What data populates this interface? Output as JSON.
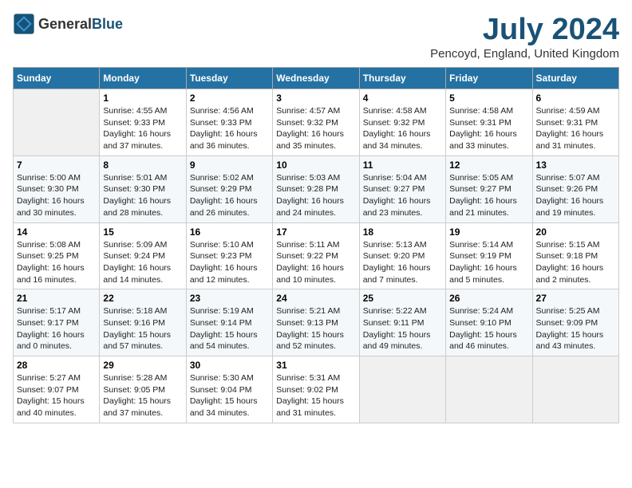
{
  "header": {
    "logo_general": "General",
    "logo_blue": "Blue",
    "title": "July 2024",
    "subtitle": "Pencoyd, England, United Kingdom"
  },
  "days_of_week": [
    "Sunday",
    "Monday",
    "Tuesday",
    "Wednesday",
    "Thursday",
    "Friday",
    "Saturday"
  ],
  "weeks": [
    {
      "days": [
        {
          "num": "",
          "info": ""
        },
        {
          "num": "1",
          "info": "Sunrise: 4:55 AM\nSunset: 9:33 PM\nDaylight: 16 hours\nand 37 minutes."
        },
        {
          "num": "2",
          "info": "Sunrise: 4:56 AM\nSunset: 9:33 PM\nDaylight: 16 hours\nand 36 minutes."
        },
        {
          "num": "3",
          "info": "Sunrise: 4:57 AM\nSunset: 9:32 PM\nDaylight: 16 hours\nand 35 minutes."
        },
        {
          "num": "4",
          "info": "Sunrise: 4:58 AM\nSunset: 9:32 PM\nDaylight: 16 hours\nand 34 minutes."
        },
        {
          "num": "5",
          "info": "Sunrise: 4:58 AM\nSunset: 9:31 PM\nDaylight: 16 hours\nand 33 minutes."
        },
        {
          "num": "6",
          "info": "Sunrise: 4:59 AM\nSunset: 9:31 PM\nDaylight: 16 hours\nand 31 minutes."
        }
      ]
    },
    {
      "days": [
        {
          "num": "7",
          "info": "Sunrise: 5:00 AM\nSunset: 9:30 PM\nDaylight: 16 hours\nand 30 minutes."
        },
        {
          "num": "8",
          "info": "Sunrise: 5:01 AM\nSunset: 9:30 PM\nDaylight: 16 hours\nand 28 minutes."
        },
        {
          "num": "9",
          "info": "Sunrise: 5:02 AM\nSunset: 9:29 PM\nDaylight: 16 hours\nand 26 minutes."
        },
        {
          "num": "10",
          "info": "Sunrise: 5:03 AM\nSunset: 9:28 PM\nDaylight: 16 hours\nand 24 minutes."
        },
        {
          "num": "11",
          "info": "Sunrise: 5:04 AM\nSunset: 9:27 PM\nDaylight: 16 hours\nand 23 minutes."
        },
        {
          "num": "12",
          "info": "Sunrise: 5:05 AM\nSunset: 9:27 PM\nDaylight: 16 hours\nand 21 minutes."
        },
        {
          "num": "13",
          "info": "Sunrise: 5:07 AM\nSunset: 9:26 PM\nDaylight: 16 hours\nand 19 minutes."
        }
      ]
    },
    {
      "days": [
        {
          "num": "14",
          "info": "Sunrise: 5:08 AM\nSunset: 9:25 PM\nDaylight: 16 hours\nand 16 minutes."
        },
        {
          "num": "15",
          "info": "Sunrise: 5:09 AM\nSunset: 9:24 PM\nDaylight: 16 hours\nand 14 minutes."
        },
        {
          "num": "16",
          "info": "Sunrise: 5:10 AM\nSunset: 9:23 PM\nDaylight: 16 hours\nand 12 minutes."
        },
        {
          "num": "17",
          "info": "Sunrise: 5:11 AM\nSunset: 9:22 PM\nDaylight: 16 hours\nand 10 minutes."
        },
        {
          "num": "18",
          "info": "Sunrise: 5:13 AM\nSunset: 9:20 PM\nDaylight: 16 hours\nand 7 minutes."
        },
        {
          "num": "19",
          "info": "Sunrise: 5:14 AM\nSunset: 9:19 PM\nDaylight: 16 hours\nand 5 minutes."
        },
        {
          "num": "20",
          "info": "Sunrise: 5:15 AM\nSunset: 9:18 PM\nDaylight: 16 hours\nand 2 minutes."
        }
      ]
    },
    {
      "days": [
        {
          "num": "21",
          "info": "Sunrise: 5:17 AM\nSunset: 9:17 PM\nDaylight: 16 hours\nand 0 minutes."
        },
        {
          "num": "22",
          "info": "Sunrise: 5:18 AM\nSunset: 9:16 PM\nDaylight: 15 hours\nand 57 minutes."
        },
        {
          "num": "23",
          "info": "Sunrise: 5:19 AM\nSunset: 9:14 PM\nDaylight: 15 hours\nand 54 minutes."
        },
        {
          "num": "24",
          "info": "Sunrise: 5:21 AM\nSunset: 9:13 PM\nDaylight: 15 hours\nand 52 minutes."
        },
        {
          "num": "25",
          "info": "Sunrise: 5:22 AM\nSunset: 9:11 PM\nDaylight: 15 hours\nand 49 minutes."
        },
        {
          "num": "26",
          "info": "Sunrise: 5:24 AM\nSunset: 9:10 PM\nDaylight: 15 hours\nand 46 minutes."
        },
        {
          "num": "27",
          "info": "Sunrise: 5:25 AM\nSunset: 9:09 PM\nDaylight: 15 hours\nand 43 minutes."
        }
      ]
    },
    {
      "days": [
        {
          "num": "28",
          "info": "Sunrise: 5:27 AM\nSunset: 9:07 PM\nDaylight: 15 hours\nand 40 minutes."
        },
        {
          "num": "29",
          "info": "Sunrise: 5:28 AM\nSunset: 9:05 PM\nDaylight: 15 hours\nand 37 minutes."
        },
        {
          "num": "30",
          "info": "Sunrise: 5:30 AM\nSunset: 9:04 PM\nDaylight: 15 hours\nand 34 minutes."
        },
        {
          "num": "31",
          "info": "Sunrise: 5:31 AM\nSunset: 9:02 PM\nDaylight: 15 hours\nand 31 minutes."
        },
        {
          "num": "",
          "info": ""
        },
        {
          "num": "",
          "info": ""
        },
        {
          "num": "",
          "info": ""
        }
      ]
    }
  ]
}
